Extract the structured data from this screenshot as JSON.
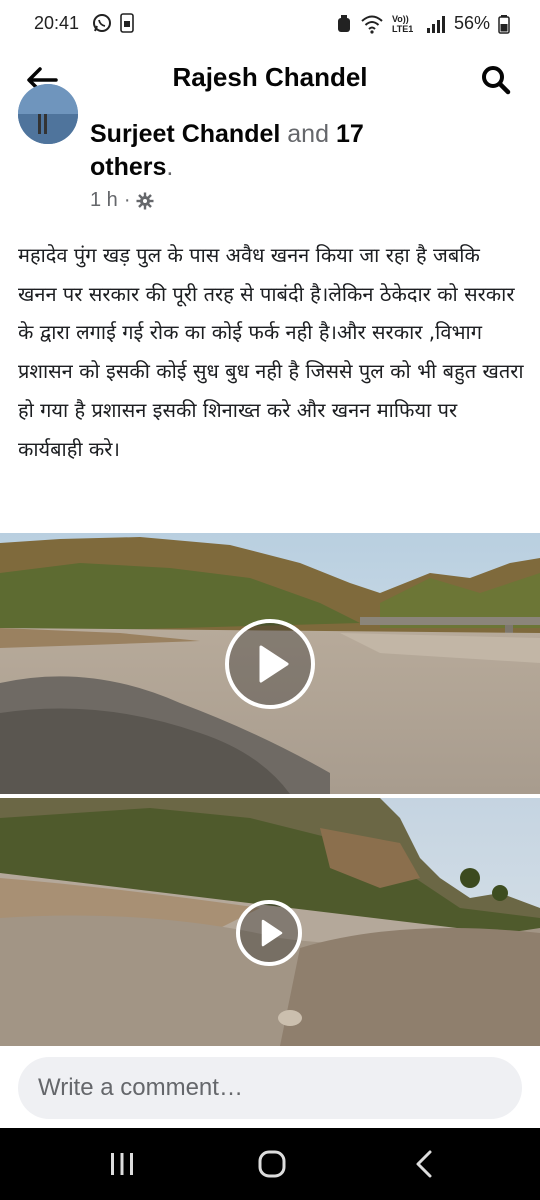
{
  "status_bar": {
    "time": "20:41",
    "battery": "56%",
    "left_icons": [
      "whatsapp-icon",
      "sim-icon"
    ],
    "right_icons": [
      "alarm-icon",
      "wifi-icon",
      "volte-icon",
      "signal-icon",
      "battery-icon"
    ],
    "volte_label": "Vo)) LTE1"
  },
  "header": {
    "title": "Rajesh Chandel",
    "back_icon": "back-arrow-icon",
    "search_icon": "search-icon"
  },
  "post": {
    "author": "Surjeet Chandel",
    "and_word": " and ",
    "others_count": "17",
    "others_word": "others",
    "period": ".",
    "time": "1 h",
    "separator": " · ",
    "privacy_icon": "gear-icon",
    "text": "महादेव पुंग खड़ पुल के पास अवैध खनन किया जा रहा है जबकि खनन पर सरकार की पूरी तरह से पाबंदी है।लेकिन ठेकेदार को सरकार के द्वारा लगाई गई रोक का कोई फर्क नही है।और सरकार ,विभाग प्रशासन को इसकी कोई सुध बुध नही है जिससे पुल को भी बहुत खतरा हो गया है प्रशासन इसकी शिनाख्त करे और खनन माफिया पर कार्यबाही करे।",
    "media": [
      {
        "type": "video",
        "icon": "play-icon",
        "description_icon": "riverbed-scene"
      },
      {
        "type": "video",
        "icon": "play-icon",
        "description_icon": "gravel-hill-scene"
      }
    ]
  },
  "comment": {
    "placeholder": "Write a comment…"
  },
  "nav_bar": {
    "icons": [
      "recent-apps-icon",
      "home-icon",
      "back-icon"
    ]
  },
  "colors": {
    "text": "#1c1e21",
    "muted": "#65676b",
    "comment_bg": "#eff0f3",
    "nav_bg": "#000000"
  }
}
